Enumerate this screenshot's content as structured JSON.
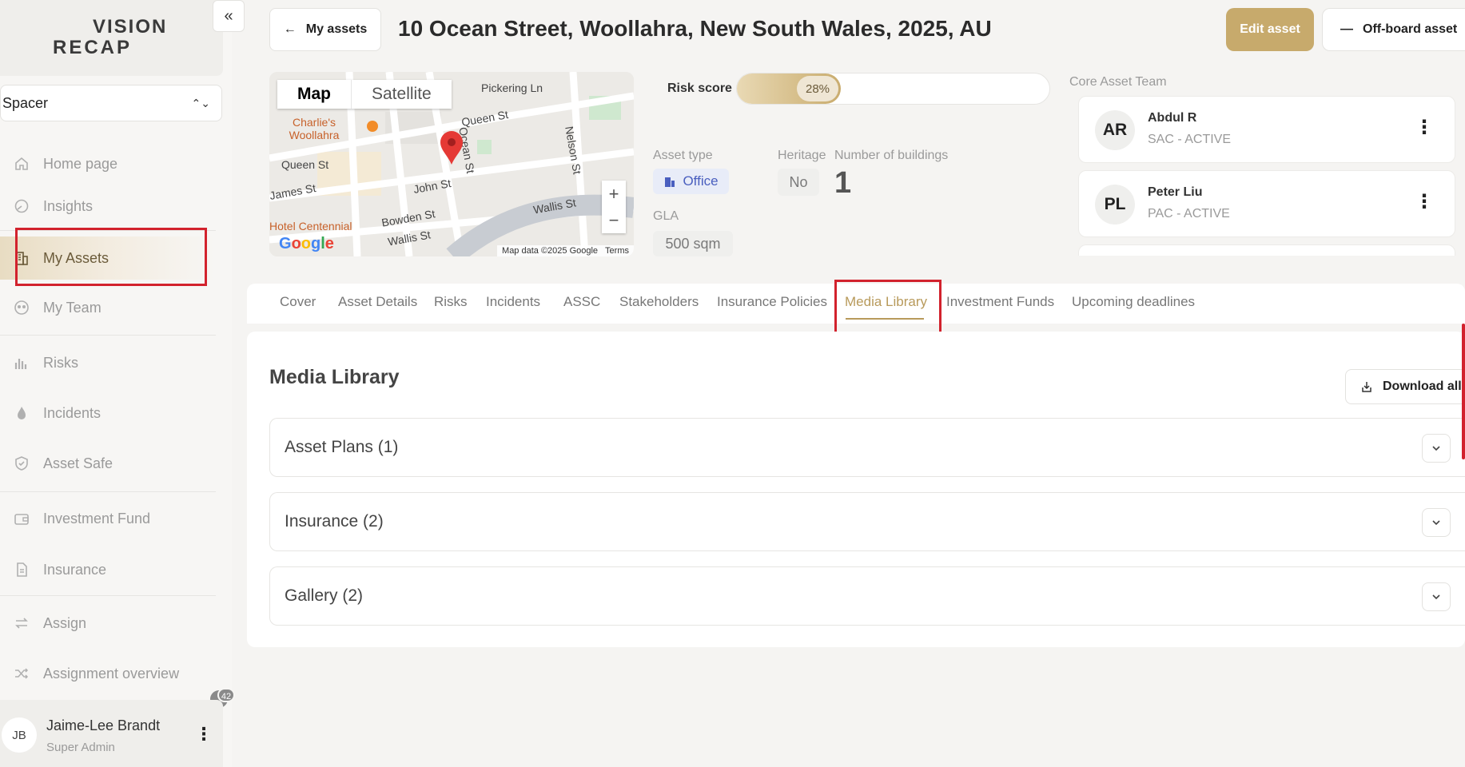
{
  "logo": {
    "line1": "VISION",
    "line2": "RECAP"
  },
  "sidebar": {
    "org_select": "Spacer",
    "items": [
      {
        "label": "Home page",
        "icon": "home-icon"
      },
      {
        "label": "Insights",
        "icon": "insights-icon"
      },
      {
        "label": "My Assets",
        "icon": "building-icon"
      },
      {
        "label": "My Team",
        "icon": "team-icon"
      },
      {
        "label": "Risks",
        "icon": "bar-chart-icon"
      },
      {
        "label": "Incidents",
        "icon": "flame-icon"
      },
      {
        "label": "Asset Safe",
        "icon": "shield-icon"
      },
      {
        "label": "Investment Fund",
        "icon": "wallet-icon"
      },
      {
        "label": "Insurance",
        "icon": "document-icon"
      },
      {
        "label": "Assign",
        "icon": "swap-icon"
      },
      {
        "label": "Assignment overview",
        "icon": "shuffle-icon"
      }
    ],
    "active": "My Assets",
    "notifications": "42",
    "user": {
      "initials": "JB",
      "name": "Jaime-Lee Brandt",
      "role": "Super Admin"
    }
  },
  "header": {
    "back_label": "My assets",
    "title": "10 Ocean Street, Woollahra, New South Wales, 2025, AU",
    "edit_label": "Edit asset",
    "offboard_label": "Off-board asset"
  },
  "map": {
    "tab_map": "Map",
    "tab_satellite": "Satellite",
    "attribution": "Map data ©2025 Google",
    "terms": "Terms",
    "labels": [
      "Pickering Ln",
      "Queen St",
      "Queen St",
      "Nelson St",
      "James St",
      "John St",
      "Wallis St",
      "Bowden St",
      "Wallis St",
      "Charlie's Woollahra",
      "Hotel Centennial",
      "Ocean St"
    ],
    "google": "Google"
  },
  "asset": {
    "risk_label": "Risk score",
    "risk_value": "28%",
    "risk_fraction": 0.28,
    "asset_type_label": "Asset type",
    "asset_type": "Office",
    "heritage_label": "Heritage",
    "heritage": "No",
    "buildings_label": "Number of buildings",
    "buildings": "1",
    "gla_label": "GLA",
    "gla": "500 sqm"
  },
  "team": {
    "title": "Core Asset Team",
    "members": [
      {
        "initials": "AR",
        "name": "Abdul R",
        "role": "SAC - ACTIVE"
      },
      {
        "initials": "PL",
        "name": "Peter Liu",
        "role": "PAC - ACTIVE"
      }
    ]
  },
  "tabs": [
    "Cover",
    "Asset Details",
    "Risks",
    "Incidents",
    "ASSC",
    "Stakeholders",
    "Insurance Policies",
    "Media Library",
    "Investment Funds",
    "Upcoming deadlines"
  ],
  "active_tab": "Media Library",
  "media": {
    "title": "Media Library",
    "download_all": "Download all",
    "sections": [
      "Asset Plans (1)",
      "Insurance (2)",
      "Gallery (2)"
    ]
  },
  "colors": {
    "accent": "#c7aa6c",
    "highlight": "#d2222d",
    "office": "#4a5fbf"
  }
}
